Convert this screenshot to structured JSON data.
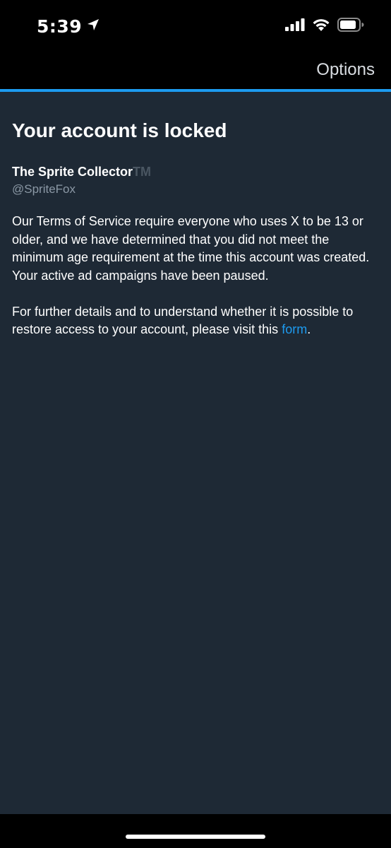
{
  "status_bar": {
    "time": "5:39",
    "icons": [
      "location-arrow-icon",
      "cellular-signal-icon",
      "wifi-icon",
      "battery-icon"
    ]
  },
  "header": {
    "options_label": "Options",
    "accent_color": "#1d9bf0"
  },
  "main": {
    "title": "Your account is locked",
    "account_name": "The Sprite Collector",
    "trademark": "TM",
    "handle": "@SpriteFox",
    "paragraph1": "Our Terms of Service require everyone who uses X to be 13 or older, and we have determined that you did not meet the minimum age requirement at the time this account was created.",
    "paragraph2": "Your active ad campaigns have been paused.",
    "paragraph3_prefix": "For further details and to understand whether it is possible to restore access to your account, please visit this ",
    "link_text": "form",
    "paragraph3_suffix": ".",
    "background_color": "#1e2935",
    "link_color": "#1d9bf0"
  }
}
